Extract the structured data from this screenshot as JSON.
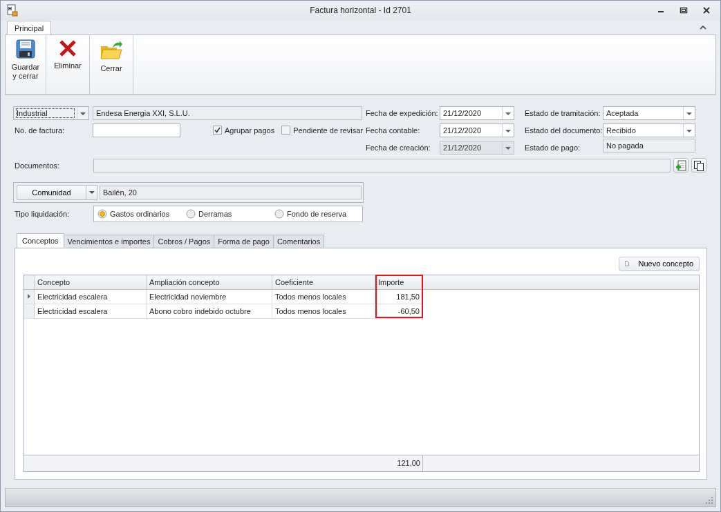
{
  "window": {
    "title": "Factura horizontal - Id 2701"
  },
  "ribbon": {
    "tabs": [
      {
        "label": "Principal",
        "selected": true
      }
    ],
    "buttons": [
      {
        "label": "Guardar y cerrar",
        "kind": "save"
      },
      {
        "label": "Eliminar",
        "kind": "delete"
      },
      {
        "label": "Cerrar",
        "kind": "close"
      }
    ]
  },
  "form": {
    "party_type": {
      "value": "Industrial"
    },
    "party_name": {
      "value": "Endesa Energia XXI, S.L.U."
    },
    "invoice_number": {
      "label": "No. de factura:"
    },
    "checkboxes": [
      {
        "label": "Agrupar pagos",
        "checked": true
      },
      {
        "label": "Pendiente de revisar",
        "checked": false
      }
    ],
    "dates": [
      {
        "label": "Fecha de expedición:",
        "value": "21/12/2020",
        "disabled": false
      },
      {
        "label": "Fecha contable:",
        "value": "21/12/2020",
        "disabled": false
      },
      {
        "label": "Fecha de creación:",
        "value": "21/12/2020",
        "disabled": true
      }
    ],
    "statuses": [
      {
        "label": "Estado de tramitación:",
        "value": "Aceptada",
        "kind": "combo"
      },
      {
        "label": "Estado del documento:",
        "value": "Recibido",
        "kind": "combo"
      },
      {
        "label": "Estado de pago:",
        "value": "No pagada",
        "kind": "readonly"
      }
    ],
    "documents": {
      "label": "Documentos:"
    },
    "community": {
      "button": "Comunidad",
      "value": "Bailén, 20"
    },
    "settlement": {
      "label": "Tipo liquidación:",
      "options": [
        {
          "label": "Gastos ordinarios",
          "selected": true
        },
        {
          "label": "Derramas",
          "selected": false
        },
        {
          "label": "Fondo de reserva",
          "selected": false
        }
      ]
    }
  },
  "tabs": [
    {
      "label": "Conceptos",
      "selected": true
    },
    {
      "label": "Vencimientos e importes",
      "selected": false
    },
    {
      "label": "Cobros / Pagos",
      "selected": false
    },
    {
      "label": "Forma de pago",
      "selected": false
    },
    {
      "label": "Comentarios",
      "selected": false
    }
  ],
  "new_button": "Nuevo concepto",
  "table": {
    "columns": [
      {
        "label": "Concepto",
        "highlighted": false
      },
      {
        "label": "Ampliación concepto",
        "highlighted": false
      },
      {
        "label": "Coeficiente",
        "highlighted": false
      },
      {
        "label": "Importe",
        "highlighted": true
      }
    ],
    "rows": [
      {
        "current": true,
        "cells": [
          "Electricidad escalera",
          "Electricidad noviembre",
          "Todos menos locales",
          "181,50"
        ]
      },
      {
        "current": false,
        "cells": [
          "Electricidad escalera",
          "Abono cobro indebido octubre",
          "Todos menos locales",
          "-60,50"
        ]
      }
    ],
    "total": "121,00"
  }
}
